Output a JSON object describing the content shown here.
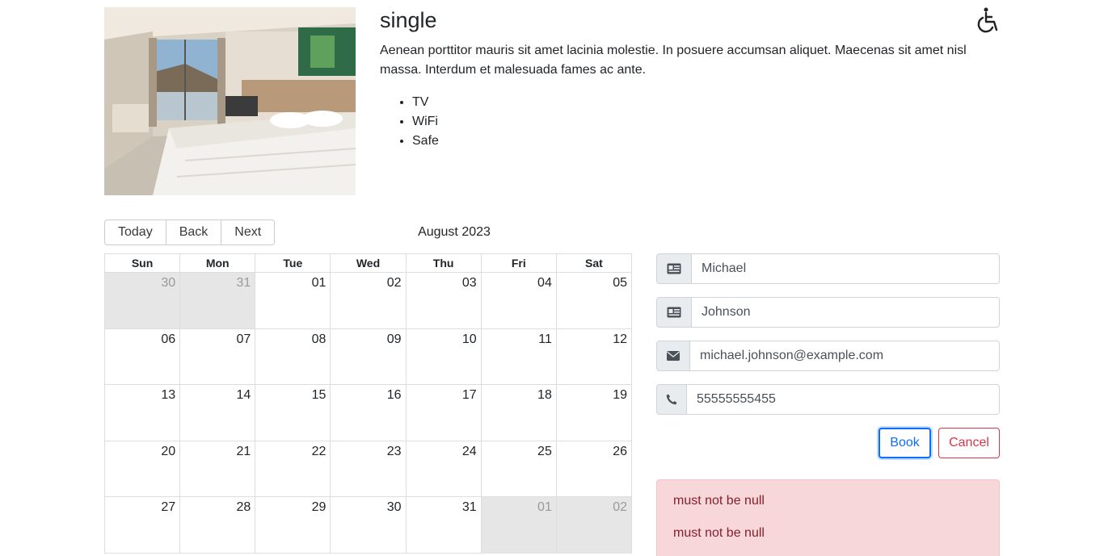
{
  "room": {
    "title": "single",
    "description": "Aenean porttitor mauris sit amet lacinia molestie. In posuere accumsan aliquet. Maecenas sit amet nisl massa. Interdum et malesuada fames ac ante.",
    "amenities": [
      "TV",
      "WiFi",
      "Safe"
    ],
    "accessibility_icon": "wheelchair-icon"
  },
  "calendar": {
    "toolbar": {
      "today": "Today",
      "back": "Back",
      "next": "Next"
    },
    "month": "August 2023",
    "weekdays": [
      "Sun",
      "Mon",
      "Tue",
      "Wed",
      "Thu",
      "Fri",
      "Sat"
    ],
    "weeks": [
      [
        {
          "d": "30",
          "off": true
        },
        {
          "d": "31",
          "off": true
        },
        {
          "d": "01"
        },
        {
          "d": "02"
        },
        {
          "d": "03"
        },
        {
          "d": "04"
        },
        {
          "d": "05"
        }
      ],
      [
        {
          "d": "06"
        },
        {
          "d": "07"
        },
        {
          "d": "08"
        },
        {
          "d": "09"
        },
        {
          "d": "10"
        },
        {
          "d": "11"
        },
        {
          "d": "12"
        }
      ],
      [
        {
          "d": "13"
        },
        {
          "d": "14"
        },
        {
          "d": "15"
        },
        {
          "d": "16"
        },
        {
          "d": "17"
        },
        {
          "d": "18"
        },
        {
          "d": "19"
        }
      ],
      [
        {
          "d": "20"
        },
        {
          "d": "21"
        },
        {
          "d": "22"
        },
        {
          "d": "23"
        },
        {
          "d": "24"
        },
        {
          "d": "25"
        },
        {
          "d": "26"
        }
      ],
      [
        {
          "d": "27"
        },
        {
          "d": "28"
        },
        {
          "d": "29"
        },
        {
          "d": "30"
        },
        {
          "d": "31"
        },
        {
          "d": "01",
          "off": true
        },
        {
          "d": "02",
          "off": true
        }
      ]
    ]
  },
  "form": {
    "firstname": {
      "value": "Michael",
      "icon": "id-card-icon"
    },
    "lastname": {
      "value": "Johnson",
      "icon": "id-card-icon"
    },
    "email": {
      "value": "michael.johnson@example.com",
      "icon": "envelope-icon"
    },
    "phone": {
      "value": "55555555455",
      "icon": "phone-icon"
    },
    "book_label": "Book",
    "cancel_label": "Cancel"
  },
  "alert": {
    "messages": [
      "must not be null",
      "must not be null"
    ]
  },
  "colors": {
    "primary": "#0d6efd",
    "danger": "#dc3545",
    "alert_bg": "#f8d7da",
    "alert_text": "#842029",
    "off_range": "#e6e6e6"
  }
}
